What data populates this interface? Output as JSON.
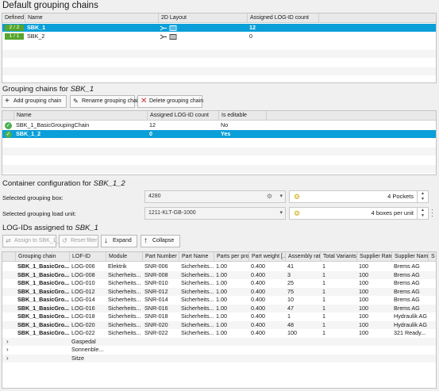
{
  "default_chains": {
    "title": "Default grouping chains",
    "columns": [
      "Defined",
      "Name",
      "2D Layout",
      "Assigned LOG-ID count"
    ],
    "rows": [
      {
        "defined": "2 / 2",
        "name": "SBK_1",
        "count": "12",
        "selected": true
      },
      {
        "defined": "1 / 1",
        "name": "SBK_2",
        "count": "0",
        "selected": false
      }
    ]
  },
  "grouping_chains": {
    "title_prefix": "Grouping chains for",
    "title_target": "SBK_1",
    "buttons": {
      "add": "Add grouping chain",
      "rename": "Rename grouping chain",
      "delete": "Delete grouping chain"
    },
    "columns": [
      "Name",
      "Assigned LOG-ID count",
      "Is editable"
    ],
    "rows": [
      {
        "name": "SBK_1_BasicGroupingChain",
        "count": "12",
        "editable": "No",
        "selected": false
      },
      {
        "name": "SBK_1_2",
        "count": "0",
        "editable": "Yes",
        "selected": true
      }
    ]
  },
  "container_config": {
    "title_prefix": "Container configuration for",
    "title_target": "SBK_1_2",
    "box_label": "Selected grouping box:",
    "box_value": "4280",
    "box_count": "4 Pockets",
    "load_label": "Selected grouping load unit:",
    "load_value": "1211-KLT-GB-1000",
    "load_count": "4 boxes per unit"
  },
  "logids": {
    "title_prefix": "LOG-IDs assigned to",
    "title_target": "SBK_1",
    "buttons": {
      "assign": "Assign to SBK_1_2",
      "reset": "Reset filter",
      "expand": "Expand",
      "collapse": "Collapse"
    },
    "columns": [
      "Grouping chain",
      "LOF-ID",
      "Module",
      "Part Number",
      "Part Name",
      "Parts per pro...",
      "Part weight [...",
      "Assembly rate",
      "Total Variants",
      "Supplier Rate",
      "Supplier Name",
      "S"
    ],
    "rows": [
      [
        "SBK_1_BasicGro...",
        "LOG-006",
        "Elektrik",
        "SNR-006",
        "Sicherheits...",
        "1.00",
        "0.400",
        "41",
        "1",
        "100",
        "Brems AG"
      ],
      [
        "SBK_1_BasicGro...",
        "LOG-008",
        "Sicherheits...",
        "SNR-008",
        "Sicherheits...",
        "1.00",
        "0.400",
        "3",
        "1",
        "100",
        "Brems AG"
      ],
      [
        "SBK_1_BasicGro...",
        "LOG-010",
        "Sicherheits...",
        "SNR-010",
        "Sicherheits...",
        "1.00",
        "0.400",
        "25",
        "1",
        "100",
        "Brems AG"
      ],
      [
        "SBK_1_BasicGro...",
        "LOG-012",
        "Sicherheits...",
        "SNR-012",
        "Sicherheits...",
        "1.00",
        "0.400",
        "75",
        "1",
        "100",
        "Brems AG"
      ],
      [
        "SBK_1_BasicGro...",
        "LOG-014",
        "Sicherheits...",
        "SNR-014",
        "Sicherheits...",
        "1.00",
        "0.400",
        "10",
        "1",
        "100",
        "Brems AG"
      ],
      [
        "SBK_1_BasicGro...",
        "LOG-016",
        "Sicherheits...",
        "SNR-016",
        "Sicherheits...",
        "1.00",
        "0.400",
        "47",
        "1",
        "100",
        "Brems AG"
      ],
      [
        "SBK_1_BasicGro...",
        "LOG-018",
        "Sicherheits...",
        "SNR-018",
        "Sicherheits...",
        "1.00",
        "0.400",
        "1",
        "1",
        "100",
        "Hydraulik AG"
      ],
      [
        "SBK_1_BasicGro...",
        "LOG-020",
        "Sicherheits...",
        "SNR-020",
        "Sicherheits...",
        "1.00",
        "0.400",
        "48",
        "1",
        "100",
        "Hydraulik AG"
      ],
      [
        "SBK_1_BasicGro...",
        "LOG-022",
        "Sicherheits...",
        "SNR-022",
        "Sicherheits...",
        "1.00",
        "0.400",
        "100",
        "1",
        "100",
        "321 Ready..."
      ]
    ],
    "groups": [
      "Gaspedal",
      "Sonnenble...",
      "Sitze"
    ]
  },
  "colors": {
    "selection": "#0a9fd8",
    "defined_pill": "#57a52b",
    "check": "#4caf50"
  }
}
